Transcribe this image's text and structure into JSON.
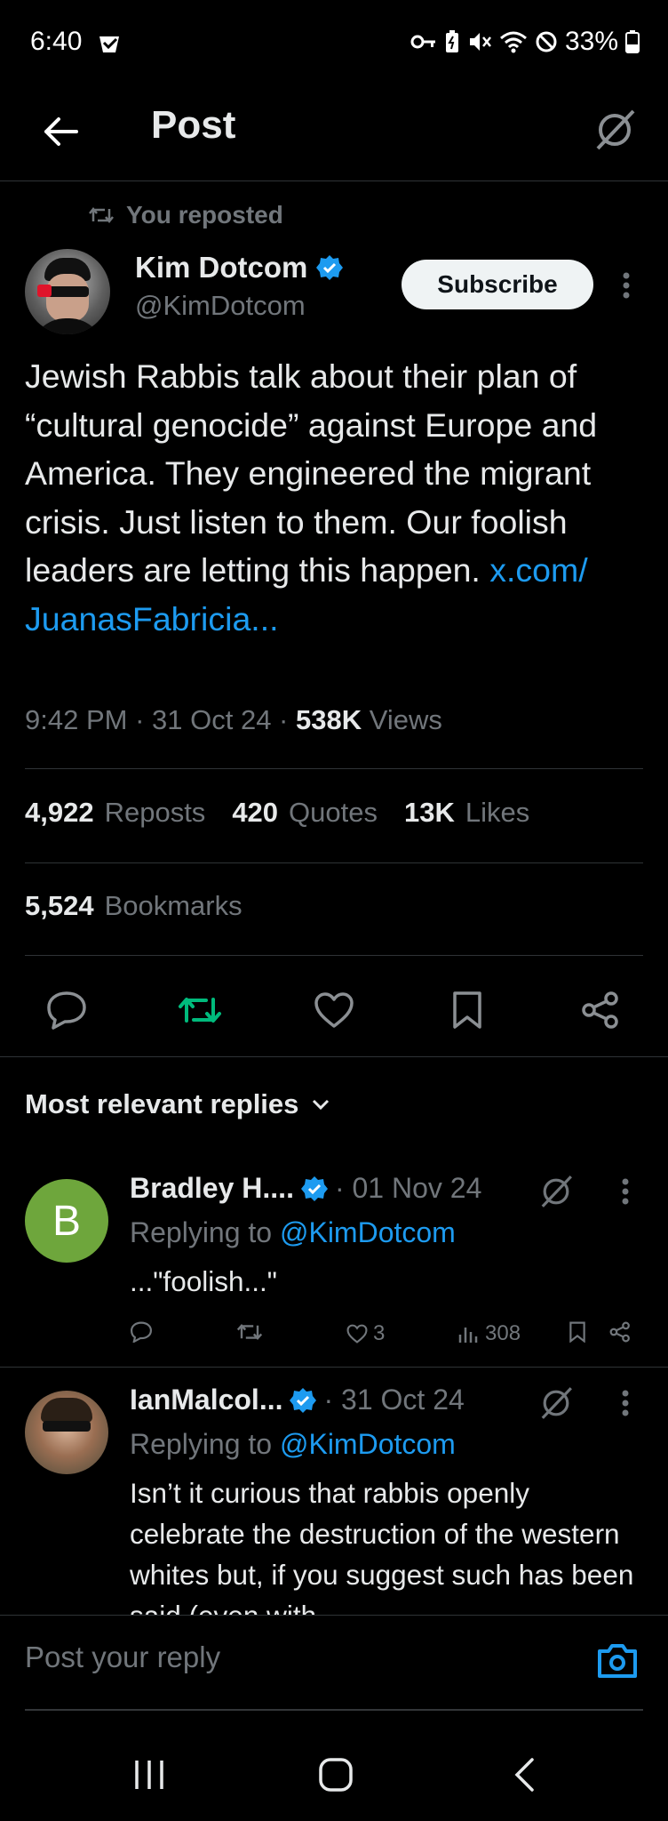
{
  "status_bar": {
    "time": "6:40",
    "battery": "33%"
  },
  "header": {
    "title": "Post"
  },
  "post": {
    "repost_context": "You reposted",
    "author_name": "Kim Dotcom",
    "author_handle": "@KimDotcom",
    "subscribe_label": "Subscribe",
    "text": "Jewish Rabbis talk about their plan of “cultural genocide” against Europe and America. They engineered the migrant crisis. Just listen to them. Our foolish leaders are letting this happen. ",
    "link": "x.com/​JuanasFabricia...",
    "time": "9:42 PM",
    "date": "31 Oct 24",
    "views_count": "538K",
    "views_label": "Views",
    "reposts_count": "4,922",
    "reposts_label": "Reposts",
    "quotes_count": "420",
    "quotes_label": "Quotes",
    "likes_count": "13K",
    "likes_label": "Likes",
    "bookmarks_count": "5,524",
    "bookmarks_label": "Bookmarks"
  },
  "replies_filter": "Most relevant replies",
  "replies": [
    {
      "avatar_letter": "B",
      "name": "Bradley H....",
      "date": "· 01 Nov 24",
      "replying_prefix": "Replying to",
      "replying_to": "@KimDotcom",
      "text": "...\"foolish...\"",
      "likes": "3",
      "views": "308"
    },
    {
      "name": "IanMalcol...",
      "date": "· 31 Oct 24",
      "replying_prefix": "Replying to",
      "replying_to": "@KimDotcom",
      "text": "Isn’t it curious that rabbis openly celebrate the destruction of the western whites but, if you suggest such has been said (even with"
    }
  ],
  "composer": {
    "placeholder": "Post your reply"
  },
  "colors": {
    "accent": "#1d9bf0",
    "repost_active": "#00ba7c",
    "avatar_b": "#6ea63c"
  }
}
